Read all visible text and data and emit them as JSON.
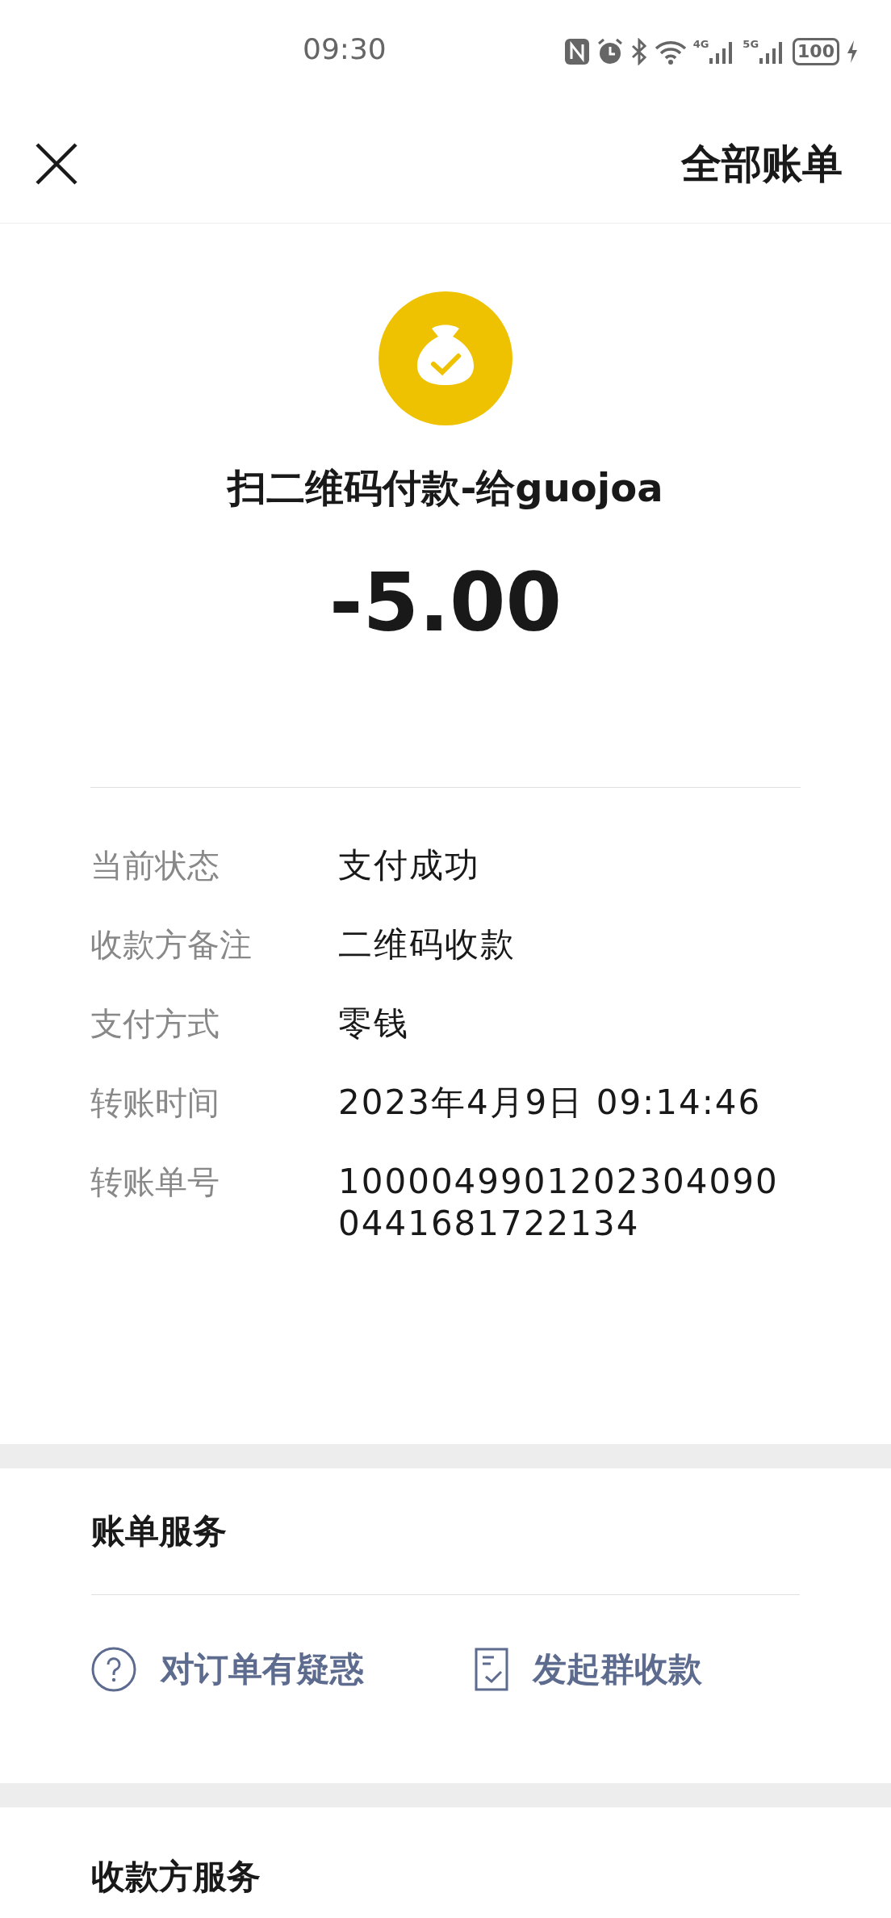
{
  "status_bar": {
    "time": "09:30",
    "network_1": "4G",
    "network_2": "5G",
    "battery": "100"
  },
  "header": {
    "title": "全部账单"
  },
  "payment": {
    "title": "扫二维码付款-给guojoa",
    "amount": "-5.00"
  },
  "details": [
    {
      "label": "当前状态",
      "value": "支付成功"
    },
    {
      "label": "收款方备注",
      "value": "二维码收款"
    },
    {
      "label": "支付方式",
      "value": "零钱"
    },
    {
      "label": "转账时间",
      "value": "2023年4月9日 09:14:46"
    },
    {
      "label": "转账单号",
      "value": "10000499012023040900441681722134"
    }
  ],
  "bill_services": {
    "title": "账单服务",
    "actions": [
      {
        "kind": "question",
        "label": "对订单有疑惑"
      },
      {
        "kind": "receipt",
        "label": "发起群收款"
      }
    ]
  },
  "payee_services": {
    "title": "收款方服务"
  }
}
